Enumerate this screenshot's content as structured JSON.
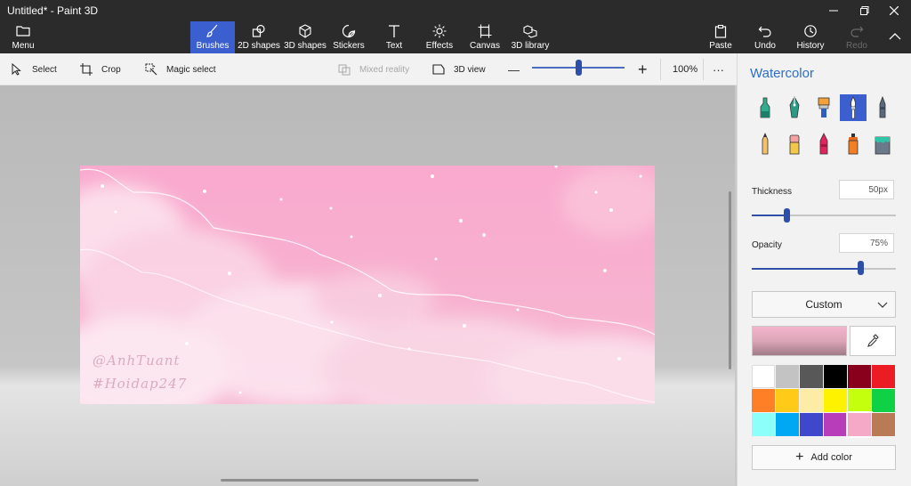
{
  "window": {
    "title": "Untitled* - Paint 3D",
    "minimize_icon": "minimize-icon",
    "maximize_icon": "maximize-icon",
    "close_icon": "close-icon"
  },
  "ribbon": {
    "menu": "Menu",
    "tabs": [
      {
        "label": "Brushes",
        "icon": "brush-icon",
        "active": true
      },
      {
        "label": "2D shapes",
        "icon": "shapes-2d-icon",
        "active": false
      },
      {
        "label": "3D shapes",
        "icon": "cube-icon",
        "active": false
      },
      {
        "label": "Stickers",
        "icon": "sticker-icon",
        "active": false
      },
      {
        "label": "Text",
        "icon": "text-icon",
        "active": false
      },
      {
        "label": "Effects",
        "icon": "sun-icon",
        "active": false
      },
      {
        "label": "Canvas",
        "icon": "canvas-icon",
        "active": false
      },
      {
        "label": "3D library",
        "icon": "library-icon",
        "active": false
      }
    ],
    "paste": "Paste",
    "undo": "Undo",
    "history": "History",
    "redo": "Redo"
  },
  "toolbar": {
    "select": "Select",
    "crop": "Crop",
    "magic_select": "Magic select",
    "mixed_reality": "Mixed reality",
    "view_3d": "3D view",
    "zoom_minus": "—",
    "zoom_plus": "+",
    "zoom_level": "100%",
    "zoom_value": 0.5,
    "more": "···"
  },
  "canvas": {
    "watermark_line1": "@AnhTuant",
    "watermark_line2": "#Hoidap247"
  },
  "panel": {
    "title": "Watercolor",
    "brushes": [
      "marker-icon",
      "calligraphy-pen-icon",
      "oil-brush-icon",
      "watercolor-icon",
      "pixel-pen-icon",
      "pencil-icon",
      "eraser-icon",
      "crayon-icon",
      "spray-can-icon",
      "fill-bucket-icon"
    ],
    "active_brush": 3,
    "thickness_label": "Thickness",
    "thickness_value": "50px",
    "thickness_level": 0.24,
    "opacity_label": "Opacity",
    "opacity_value": "75%",
    "opacity_level": 0.75,
    "color_mode": "Custom",
    "palette": [
      "#ffffff",
      "#c3c3c3",
      "#585858",
      "#000000",
      "#88001b",
      "#ec1c24",
      "#ff7f27",
      "#ffca18",
      "#fdeca6",
      "#fff200",
      "#c4ff0e",
      "#0ed145",
      "#8cfffb",
      "#00a8f3",
      "#3f48cc",
      "#b83dba",
      "#f5a9c6",
      "#b97a56"
    ],
    "selected_color": 16,
    "add_color": "Add color"
  }
}
